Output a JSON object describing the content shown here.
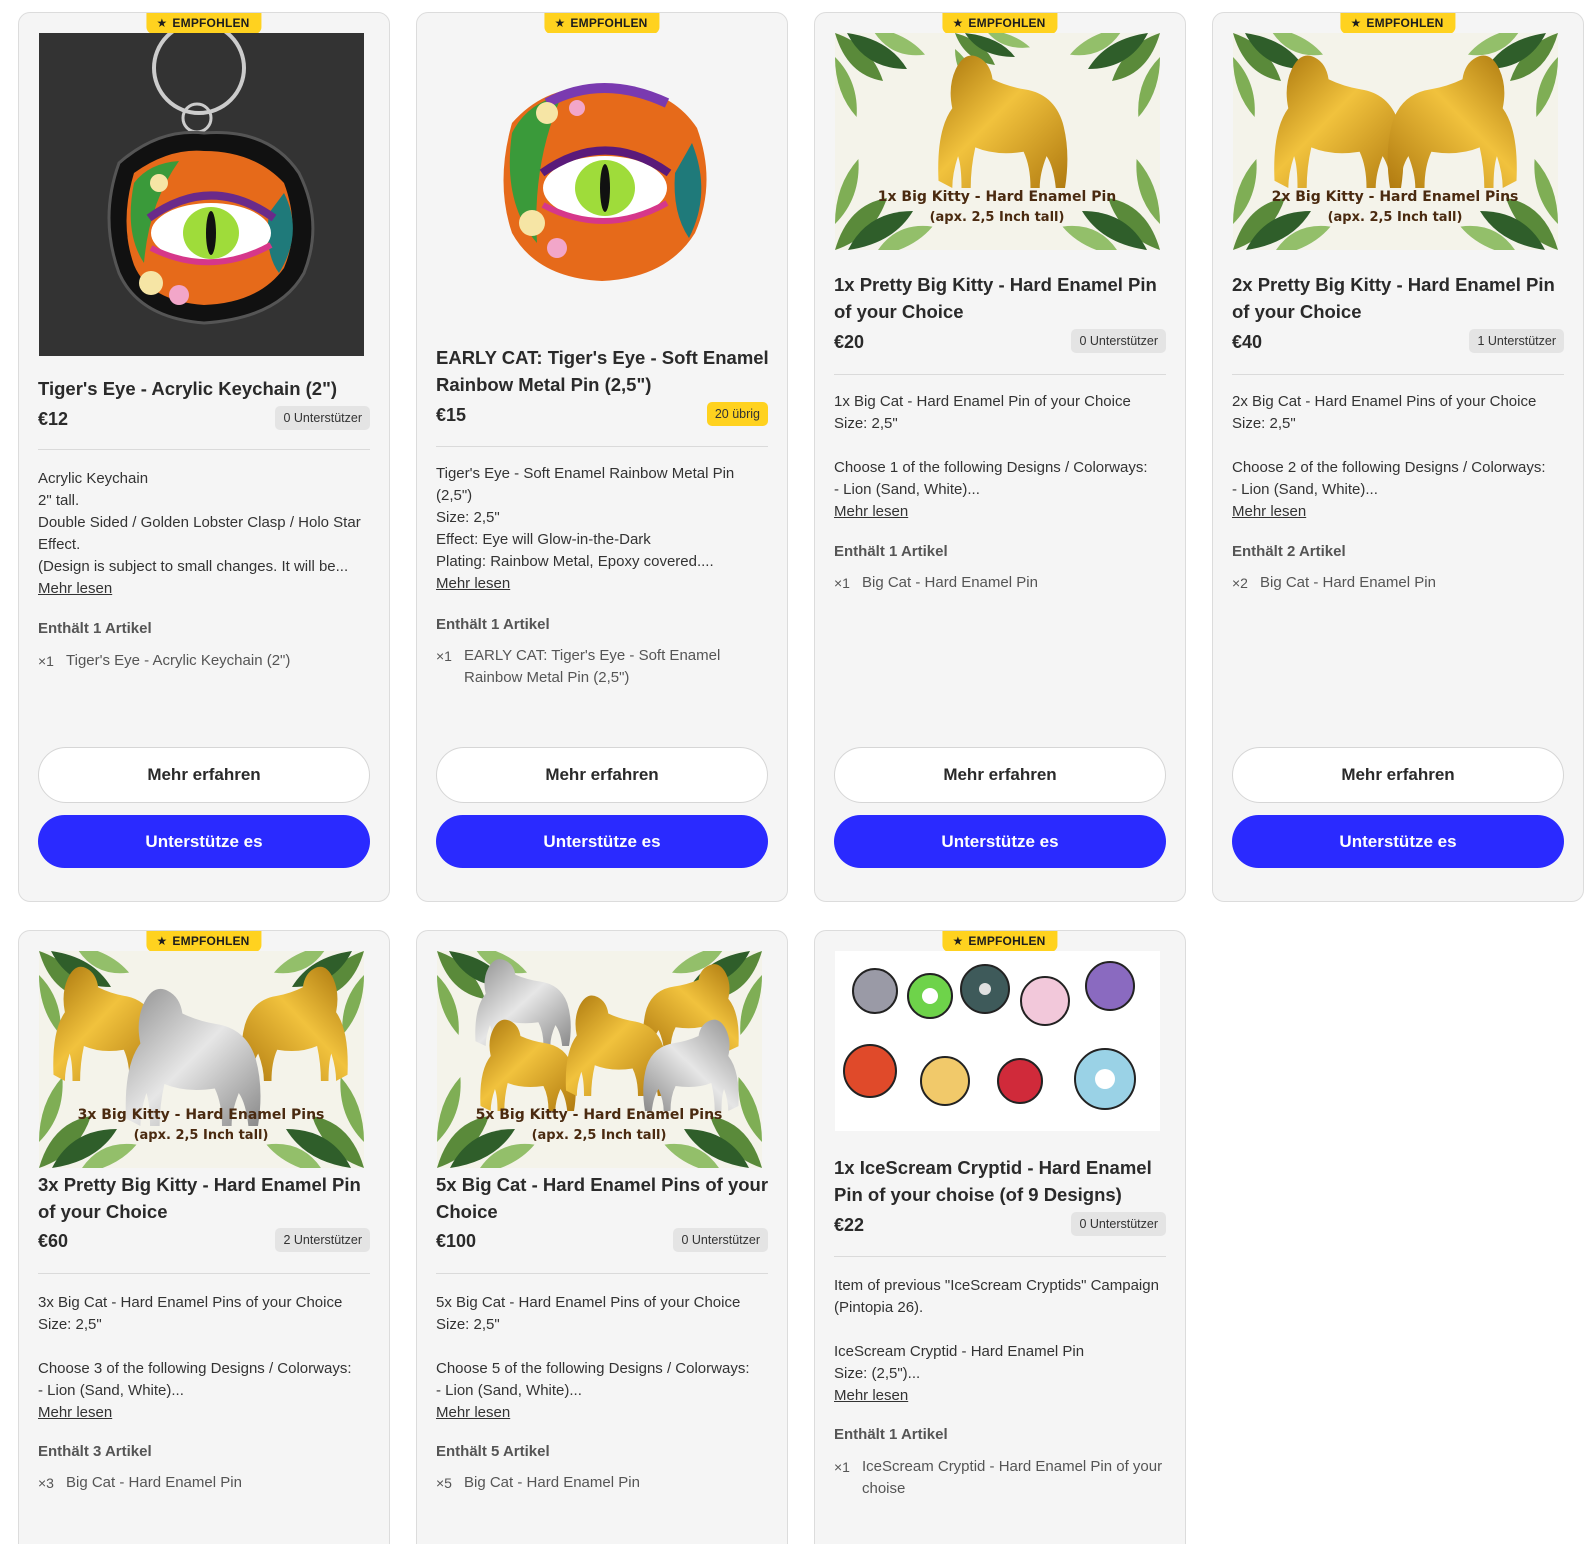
{
  "common": {
    "featured_label": "EMPFOHLEN",
    "read_more": "Mehr lesen",
    "learn_more": "Mehr erfahren",
    "support": "Unterstütze es"
  },
  "cards": [
    {
      "title": "Tiger's Eye - Acrylic Keychain (2\")",
      "price": "€12",
      "backers": "0 Unterstützer",
      "description": "Acrylic Keychain\n2\" tall.\nDouble Sided / Golden Lobster Clasp / Holo Star Effect.\n(Design is subject to small changes. It will be...",
      "contains": "Enthält 1 Artikel",
      "items": [
        {
          "qty": "×1",
          "name": "Tiger's Eye - Acrylic Keychain (2\")"
        }
      ]
    },
    {
      "title": "EARLY CAT: Tiger's Eye - Soft Enamel Rainbow Metal Pin (2,5\")",
      "price": "€15",
      "backers": "20 übrig",
      "description": "Tiger's Eye - Soft Enamel Rainbow Metal Pin (2,5\")\nSize: 2,5\"\nEffect: Eye will Glow-in-the-Dark\nPlating: Rainbow Metal, Epoxy covered....",
      "contains": "Enthält 1 Artikel",
      "items": [
        {
          "qty": "×1",
          "name": "EARLY CAT: Tiger's Eye - Soft Enamel Rainbow Metal Pin (2,5\")"
        }
      ]
    },
    {
      "title": "1x Pretty Big Kitty - Hard Enamel Pin of your Choice",
      "price": "€20",
      "backers": "0 Unterstützer",
      "image_text_1": "1x Big Kitty - Hard Enamel Pin",
      "image_text_2": "(apx. 2,5 Inch tall)",
      "description": "1x Big Cat - Hard Enamel Pin of your Choice\nSize: 2,5\"\n\nChoose 1 of the following Designs / Colorways:\n- Lion (Sand, White)...",
      "contains": "Enthält 1 Artikel",
      "items": [
        {
          "qty": "×1",
          "name": "Big Cat - Hard Enamel Pin"
        }
      ]
    },
    {
      "title": "2x Pretty Big Kitty - Hard Enamel Pin of your Choice",
      "price": "€40",
      "backers": "1 Unterstützer",
      "image_text_1": "2x Big Kitty - Hard Enamel Pins",
      "image_text_2": "(apx. 2,5 Inch tall)",
      "description": "2x Big Cat - Hard Enamel Pins of your Choice\nSize: 2,5\"\n\nChoose 2 of the following Designs / Colorways:\n- Lion (Sand, White)...",
      "contains": "Enthält 2 Artikel",
      "items": [
        {
          "qty": "×2",
          "name": "Big Cat - Hard Enamel Pin"
        }
      ]
    },
    {
      "title": "3x Pretty Big Kitty - Hard Enamel Pin of your Choice",
      "price": "€60",
      "backers": "2 Unterstützer",
      "image_text_1": "3x Big Kitty - Hard Enamel Pins",
      "image_text_2": "(apx. 2,5 Inch tall)",
      "description": "3x Big Cat - Hard Enamel Pins of your Choice\nSize: 2,5\"\n\nChoose 3 of the following Designs / Colorways:\n- Lion (Sand, White)...",
      "contains": "Enthält 3 Artikel",
      "items": [
        {
          "qty": "×3",
          "name": "Big Cat - Hard Enamel Pin"
        }
      ]
    },
    {
      "title": "5x Big Cat - Hard Enamel Pins of your Choice",
      "price": "€100",
      "backers": "0 Unterstützer",
      "image_text_1": "5x Big Kitty - Hard Enamel Pins",
      "image_text_2": "(apx. 2,5 Inch tall)",
      "description": "5x Big Cat - Hard Enamel Pins of your Choice\nSize: 2,5\"\n\nChoose 5 of the following Designs / Colorways:\n- Lion (Sand, White)...",
      "contains": "Enthält 5 Artikel",
      "items": [
        {
          "qty": "×5",
          "name": "Big Cat - Hard Enamel Pin"
        }
      ]
    },
    {
      "title": "1x IceScream Cryptid - Hard Enamel Pin of your choise (of 9 Designs)",
      "price": "€22",
      "backers": "0 Unterstützer",
      "description": "Item of previous \"IceScream Cryptids\" Campaign (Pintopia 26).\n\nIceScream Cryptid - Hard Enamel Pin\nSize: (2,5\")...",
      "contains": "Enthält 1 Artikel",
      "items": [
        {
          "qty": "×1",
          "name": "IceScream Cryptid - Hard Enamel Pin of your choise"
        }
      ]
    }
  ],
  "colors": {
    "accent": "#2a2aff",
    "badge": "#ffd21f",
    "gold": "#d39a1a",
    "silver": "#b8b8b8"
  }
}
